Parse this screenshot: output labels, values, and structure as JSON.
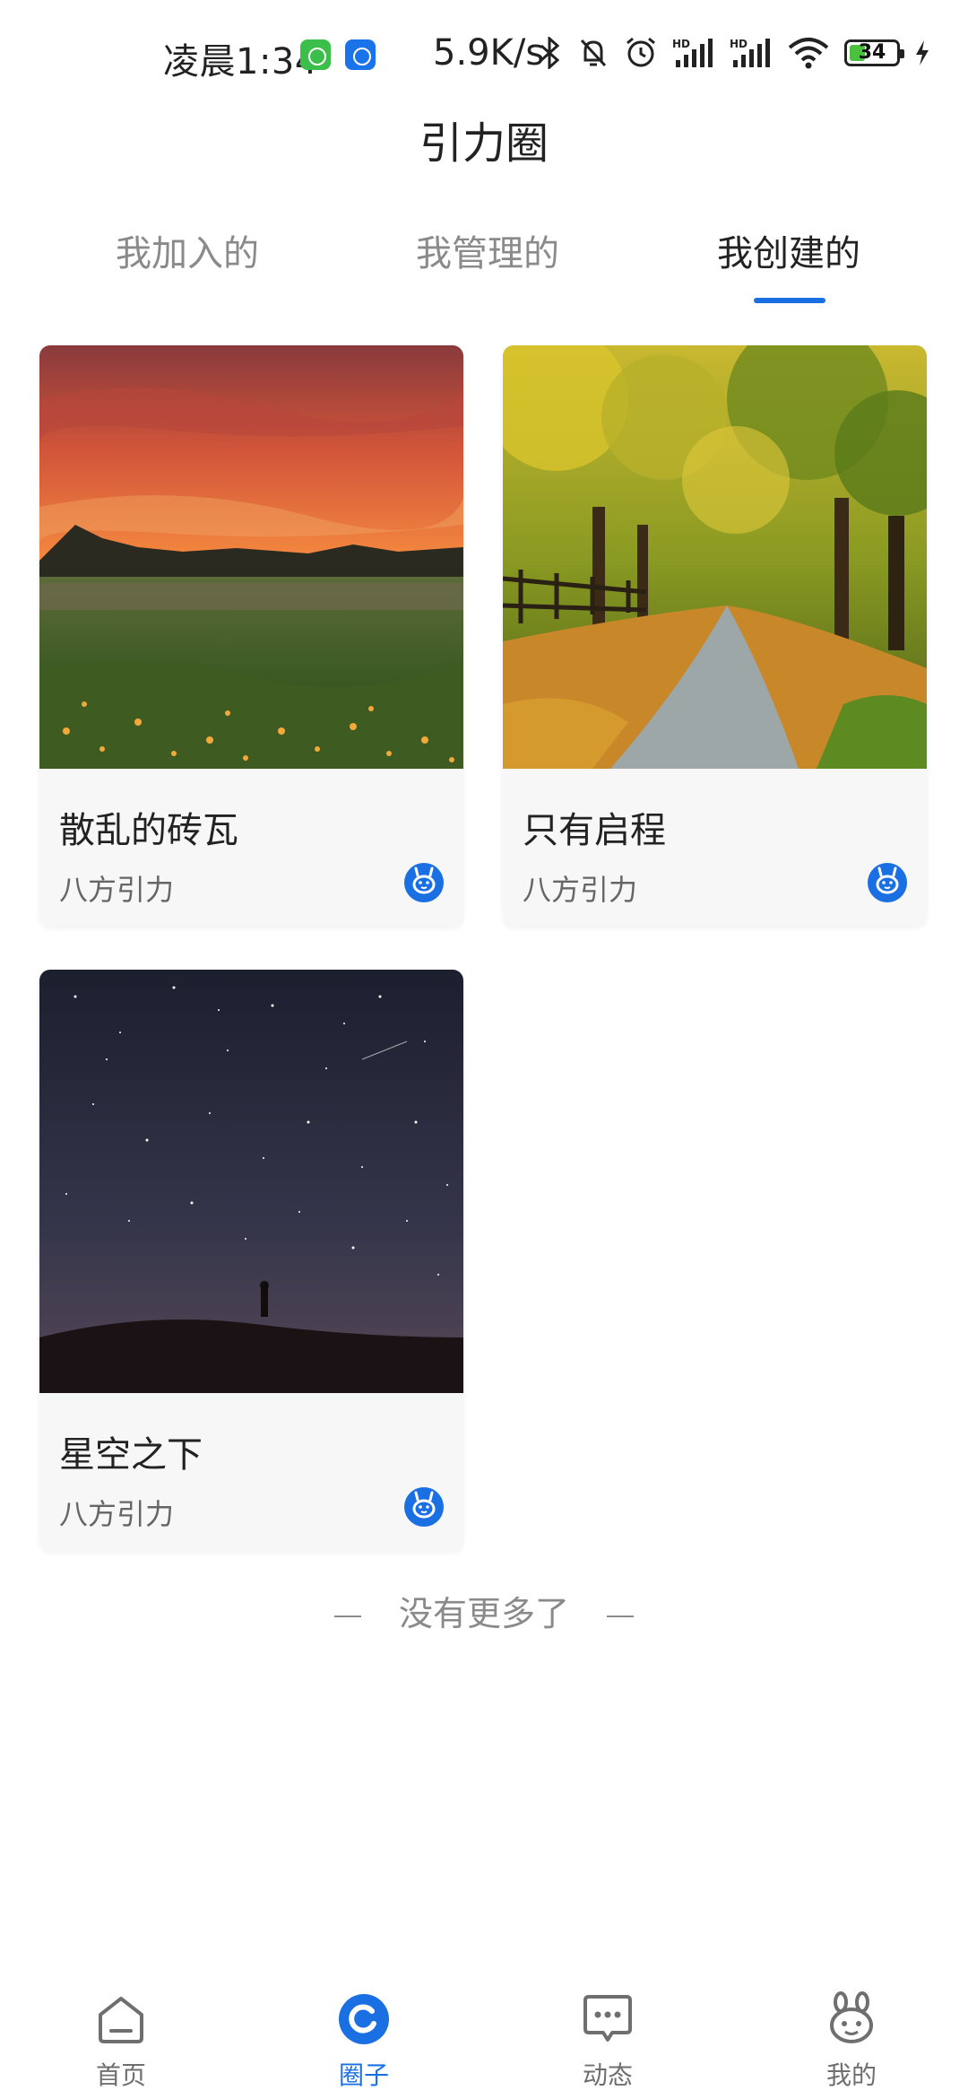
{
  "status_bar": {
    "time": "凌晨1:34",
    "net_speed": "5.9K/s",
    "battery_level": "34",
    "battery_fraction": 0.34,
    "icons": [
      "wechat-icon",
      "baidu-icon",
      "bluetooth-icon",
      "mute-icon",
      "alarm-icon",
      "signal-hd-icon",
      "signal-hd-icon",
      "wifi-icon",
      "battery-icon",
      "charging-icon"
    ]
  },
  "header": {
    "title": "引力圈"
  },
  "tabs": [
    {
      "label": "我加入的"
    },
    {
      "label": "我管理的"
    },
    {
      "label": "我创建的",
      "active": true
    }
  ],
  "circles": [
    {
      "name": "散乱的砖瓦",
      "owner": "八方引力",
      "cover": "sunset-field-image",
      "badge_icon": "bunny-face-icon"
    },
    {
      "name": "只有启程",
      "owner": "八方引力",
      "cover": "autumn-road-image",
      "badge_icon": "bunny-face-icon"
    },
    {
      "name": "星空之下",
      "owner": "八方引力",
      "cover": "starry-night-image",
      "badge_icon": "bunny-face-icon"
    }
  ],
  "end_note": "没有更多了",
  "bottom_nav": [
    {
      "label": "首页",
      "icon": "home-icon"
    },
    {
      "label": "圈子",
      "icon": "circle-icon",
      "active": true
    },
    {
      "label": "动态",
      "icon": "message-icon"
    },
    {
      "label": "我的",
      "icon": "bunny-icon"
    }
  ],
  "colors": {
    "accent": "#1a6fe3",
    "inactive_tab": "#8a8a8a",
    "card_bg": "#f7f7f7"
  }
}
